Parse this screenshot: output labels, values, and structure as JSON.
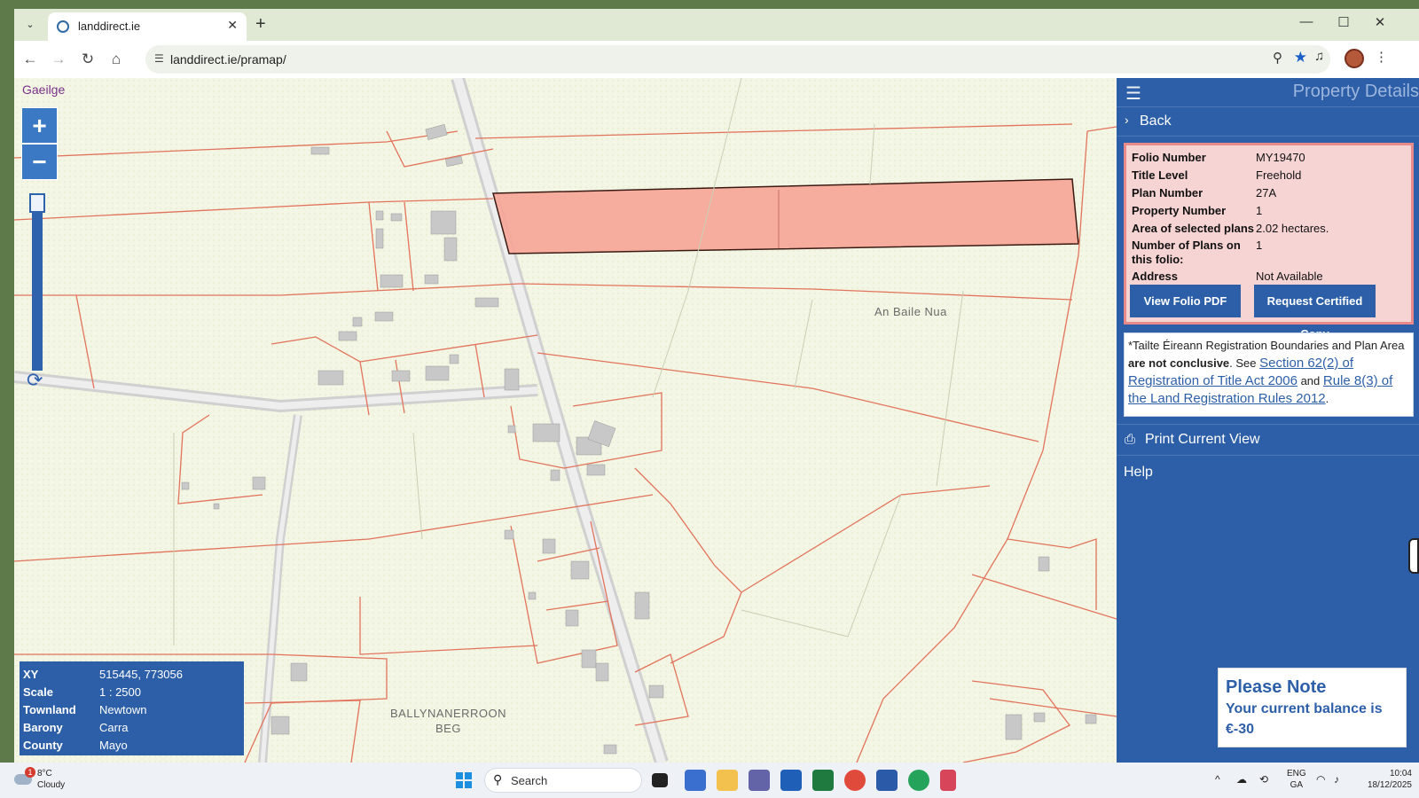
{
  "browser": {
    "tab_title": "landdirect.ie",
    "url": "landdirect.ie/pramap/"
  },
  "map": {
    "language_link": "Gaeilge",
    "zoom_in": "+",
    "zoom_out": "−",
    "place_labels": {
      "an_baile_nua": "An Baile Nua",
      "ballynanerroon_1": "BALLYNANERROON",
      "ballynanerroon_2": "BEG"
    },
    "info": {
      "xy_label": "XY",
      "xy": "515445, 773056",
      "scale_label": "Scale",
      "scale": "1 : 2500",
      "townland_label": "Townland",
      "townland": "Newtown",
      "barony_label": "Barony",
      "barony": "Carra",
      "county_label": "County",
      "county": "Mayo"
    },
    "colors": {
      "parcel_line": "#e2735c",
      "selected_fill": "#f6a596",
      "road": "#d9d9d9"
    }
  },
  "panel": {
    "title": "Property Details",
    "back": "Back",
    "folio": {
      "folio_number_label": "Folio Number",
      "folio_number": "MY19470",
      "title_level_label": "Title Level",
      "title_level": "Freehold",
      "plan_number_label": "Plan Number",
      "plan_number": "27A",
      "property_number_label": "Property Number",
      "property_number": "1",
      "area_label": "Area of selected plans",
      "area": "2.02 hectares.",
      "plans_label": "Number of Plans on this folio:",
      "plans": "1",
      "address_label": "Address",
      "address": "Not Available",
      "view_pdf": "View Folio PDF",
      "request_copy": "Request Certified Copy"
    },
    "notice": {
      "part1": "*Tailte Éireann Registration Boundaries and Plan Area",
      "bold": "are not conclusive",
      "part2": ". See",
      "link1": "Section 62(2) of Registration of Title Act 2006",
      "and": "and",
      "link2": "Rule 8(3) of the Land Registration Rules 2012",
      "end": "."
    },
    "print": "Print Current View",
    "help": "Help"
  },
  "balance_note": {
    "title": "Please Note",
    "line1": "Your current balance is",
    "line2": "€-30"
  },
  "taskbar": {
    "temp": "8°C",
    "condition": "Cloudy",
    "weather_badge": "1",
    "search": "Search",
    "lang1": "ENG",
    "lang2": "GA",
    "time": "10:04",
    "date": "18/12/2025"
  }
}
